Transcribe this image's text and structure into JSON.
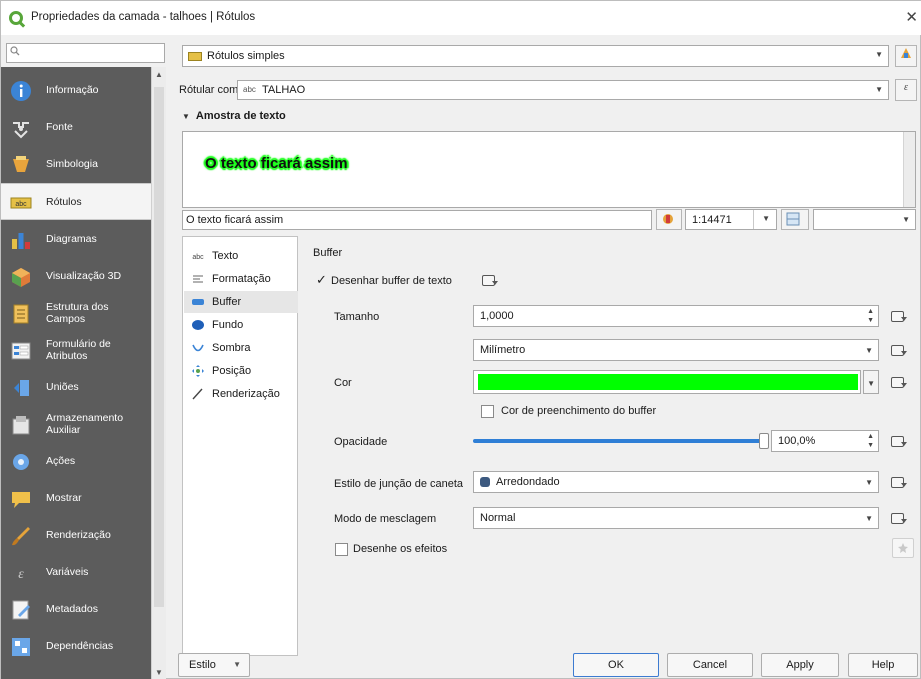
{
  "window": {
    "title": "Propriedades da camada - talhoes | Rótulos",
    "close_glyph": "✕"
  },
  "search": {
    "placeholder": ""
  },
  "sidebar": {
    "items": [
      {
        "label": "Informação",
        "icon": "info-icon",
        "color": "#3b84d6"
      },
      {
        "label": "Fonte",
        "icon": "source-icon",
        "color": "#dadada"
      },
      {
        "label": "Simbologia",
        "icon": "symbology-icon",
        "color": "#e8a43c"
      },
      {
        "label": "Rótulos",
        "icon": "labels-icon",
        "color": "#e5c046",
        "active": true
      },
      {
        "label": "Diagramas",
        "icon": "diagrams-icon",
        "color": "#e5c046"
      },
      {
        "label": "Visualização 3D",
        "icon": "3d-view-icon",
        "color": "#e07b39"
      },
      {
        "label": "Estrutura dos Campos",
        "icon": "fields-icon",
        "color": "#f0c15c"
      },
      {
        "label": "Formulário de Atributos",
        "icon": "attributes-form-icon",
        "color": "#d9d9d9"
      },
      {
        "label": "Uniões",
        "icon": "joins-icon",
        "color": "#3b84d6"
      },
      {
        "label": "Armazenamento Auxiliar",
        "icon": "auxiliary-storage-icon",
        "color": "#dadada"
      },
      {
        "label": "Ações",
        "icon": "actions-icon",
        "color": "#6aa6e8"
      },
      {
        "label": "Mostrar",
        "icon": "display-icon",
        "color": "#f0c04a"
      },
      {
        "label": "Renderização",
        "icon": "rendering-icon",
        "color": "#e5a33a"
      },
      {
        "label": "Variáveis",
        "icon": "variables-icon",
        "color": "#bdbdbd"
      },
      {
        "label": "Metadados",
        "icon": "metadata-icon",
        "color": "#6aa6e8"
      },
      {
        "label": "Dependências",
        "icon": "dependencies-icon",
        "color": "#6aa6e8"
      }
    ]
  },
  "labeling": {
    "mode": "Rótulos simples",
    "label_with_label": "Rótular com",
    "label_with_prefix": "abc",
    "label_with_value": "TALHAO",
    "sample_section": "Amostra de texto",
    "sample_preview": "O texto ficará assim",
    "sample_input": "O texto ficará assim",
    "scale": "1:14471"
  },
  "tabs": [
    {
      "label": "Texto",
      "icon": "text-tab-icon"
    },
    {
      "label": "Formatação",
      "icon": "formatting-tab-icon"
    },
    {
      "label": "Buffer",
      "icon": "buffer-tab-icon",
      "active": true
    },
    {
      "label": "Fundo",
      "icon": "background-tab-icon"
    },
    {
      "label": "Sombra",
      "icon": "shadow-tab-icon"
    },
    {
      "label": "Posição",
      "icon": "placement-tab-icon"
    },
    {
      "label": "Renderização",
      "icon": "rendering-tab-icon"
    }
  ],
  "buffer": {
    "heading": "Buffer",
    "draw_buffer_label": "Desenhar buffer de texto",
    "size_label": "Tamanho",
    "size_value": "1,0000",
    "unit_value": "Milímetro",
    "color_label": "Cor",
    "color_value": "#00ff00",
    "fill_label": "Cor de preenchimento do buffer",
    "opacity_label": "Opacidade",
    "opacity_value": "100,0%",
    "opacity_fraction": 1.0,
    "join_label": "Estilo de junção de caneta",
    "join_value": "Arredondado",
    "blend_label": "Modo de mesclagem",
    "blend_value": "Normal",
    "effects_label": "Desenhe os efeitos"
  },
  "footer": {
    "style_label": "Estilo",
    "ok": "OK",
    "cancel": "Cancel",
    "apply": "Apply",
    "help": "Help"
  }
}
